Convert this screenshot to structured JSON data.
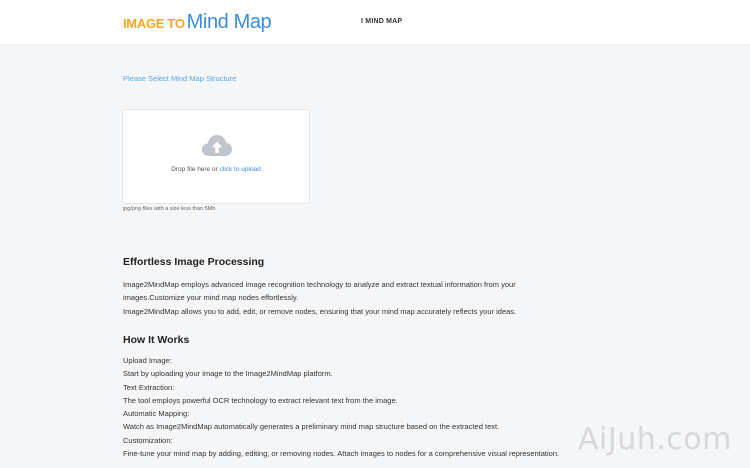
{
  "header": {
    "logo_part1": "IMAGE TO",
    "logo_part2": "Mind Map",
    "nav_link": "I MIND MAP"
  },
  "upload": {
    "select_prompt": "Please Select Mind Map Structure",
    "drop_text": "Drop file here or ",
    "click_link": "click to upload",
    "file_hint": "jpg/png files with a size less than 5Mb",
    "icon": "cloud-upload-icon"
  },
  "section1": {
    "title": "Effortless Image Processing",
    "lines": [
      "Image2MindMap employs advanced image recognition technology to analyze and extract textual information from your",
      "images.Customize your mind map nodes effortlessly.",
      "Image2MindMap allows you to add, edit, or remove nodes, ensuring that your mind map accurately reflects your ideas."
    ]
  },
  "section2": {
    "title": "How It Works",
    "lines": [
      "Upload Image:",
      "Start by uploading your image to the Image2MindMap platform.",
      "Text Extraction:",
      "The tool employs powerful OCR technology to extract relevant text from the image.",
      "Automatic Mapping:",
      "Watch as Image2MindMap automatically generates a preliminary mind map structure based on the extracted text.",
      "Customization:",
      "Fine-tune your mind map by adding, editing, or removing nodes. Attach images to nodes for a comprehensive visual representation."
    ]
  },
  "watermark": "AiJuh.com",
  "colors": {
    "accent_blue": "#3b8ddb",
    "logo_orange": "#f5a623",
    "background": "#f5f6f8"
  }
}
